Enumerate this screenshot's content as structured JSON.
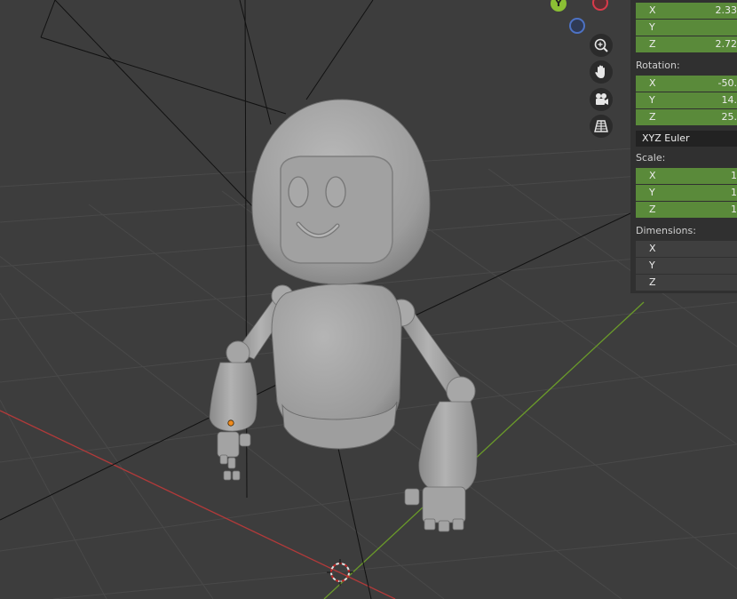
{
  "gizmo": {
    "y_label": "Y",
    "colors": {
      "y": "#8bbf34",
      "x": "#d93a4a",
      "z": "#4d72c4"
    }
  },
  "nav": {
    "zoom_icon": "zoom-icon",
    "pan_icon": "hand-pan-icon",
    "camera_icon": "camera-icon",
    "grid_icon": "grid-toggle-icon"
  },
  "transform": {
    "location": [
      {
        "axis": "X",
        "value": "2.33"
      },
      {
        "axis": "Y",
        "value": ""
      },
      {
        "axis": "Z",
        "value": "2.72"
      }
    ],
    "rotation_label": "Rotation:",
    "rotation": [
      {
        "axis": "X",
        "value": "-50."
      },
      {
        "axis": "Y",
        "value": "14."
      },
      {
        "axis": "Z",
        "value": "25."
      }
    ],
    "rotation_mode": "XYZ Euler",
    "scale_label": "Scale:",
    "scale": [
      {
        "axis": "X",
        "value": "1"
      },
      {
        "axis": "Y",
        "value": "1"
      },
      {
        "axis": "Z",
        "value": "1"
      }
    ],
    "dimensions_label": "Dimensions:",
    "dimensions": [
      {
        "axis": "X",
        "value": ""
      },
      {
        "axis": "Y",
        "value": ""
      },
      {
        "axis": "Z",
        "value": ""
      }
    ]
  },
  "colors": {
    "background": "#3d3d3d",
    "grid": "#4a4a4a",
    "x_axis": "#b13a3a",
    "y_axis": "#6a9a2a",
    "field_green": "#5a8a3a",
    "model": "#a7a7a7"
  }
}
